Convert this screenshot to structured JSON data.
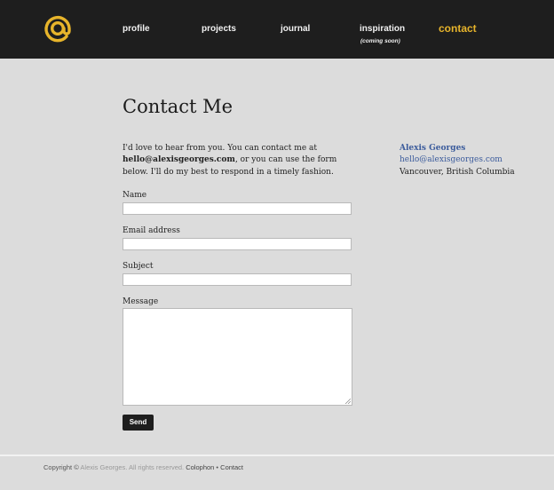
{
  "nav": {
    "profile": "profile",
    "projects": "projects",
    "journal": "journal",
    "inspiration": "inspiration",
    "inspiration_note": "(coming soon)",
    "contact": "contact"
  },
  "page": {
    "title": "Contact Me",
    "intro_1": "I'd love to hear from you. You can contact me at",
    "intro_email": "hello@alexisgeorges.com",
    "intro_2": ", or you can use the form below. I'll do my best to respond in a timely fashion."
  },
  "sidebar": {
    "name": "Alexis Georges",
    "email": "hello@alexisgeorges.com",
    "location": "Vancouver, British Columbia"
  },
  "form": {
    "name_label": "Name",
    "name_value": "",
    "email_label": "Email address",
    "email_value": "",
    "subject_label": "Subject",
    "subject_value": "",
    "message_label": "Message",
    "message_value": "",
    "send_label": "Send"
  },
  "footer": {
    "copyright": "Copyright",
    "symbol": "©",
    "owner": "Alexis Georges. All rights reserved.",
    "colophon": "Colophon",
    "separator": "•",
    "contact": "Contact"
  },
  "colors": {
    "accent": "#e7b42b",
    "header_bg": "#1e1e1e",
    "link": "#3c5c9c",
    "page_bg": "#dcdcdc"
  },
  "icons": {
    "logo": "at-sign-logo-icon",
    "resize": "resize-grip-icon"
  }
}
